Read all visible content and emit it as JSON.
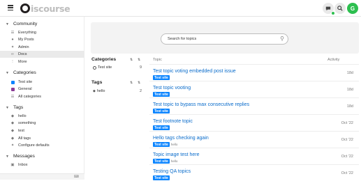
{
  "header": {
    "logo_text": "iscourse",
    "avatar_letter": "G",
    "icons": [
      "menu-icon",
      "chat-icon",
      "search-icon"
    ]
  },
  "coord_readout": "1332.4 × 44",
  "sidebar": {
    "community_label": "Community",
    "community_items": [
      {
        "label": "Everything",
        "icon": "layers-icon"
      },
      {
        "label": "My Posts",
        "icon": "user-icon"
      },
      {
        "label": "Admin",
        "icon": "wrench-icon"
      },
      {
        "label": "Docs",
        "icon": "link-icon",
        "active": true
      },
      {
        "label": "More",
        "icon": "ellipsis-icon"
      }
    ],
    "categories_label": "Categories",
    "category_items": [
      {
        "label": "Test site",
        "color": "#0a84ff"
      },
      {
        "label": "General",
        "color": "#8b3c95"
      },
      {
        "label": "All categories",
        "color": "#9a9a9a"
      }
    ],
    "tags_label": "Tags",
    "tag_items": [
      "hello",
      "something",
      "test",
      "All tags",
      "Configure defaults"
    ],
    "messages_label": "Messages",
    "message_items": [
      "Inbox"
    ],
    "footer_icon": "keyboard-icon"
  },
  "main": {
    "search_placeholder": "Search for topics",
    "categories_title": "Categories",
    "categories": [
      {
        "label": "Test site",
        "count": "9"
      }
    ],
    "tags_title": "Tags",
    "tags": [
      {
        "label": "hello",
        "count": "2"
      }
    ],
    "topic_header": "Topic",
    "activity_header": "Activity",
    "topics": [
      {
        "title": "Test topic voting embedded post issue",
        "category": "Test site",
        "tag": "",
        "activity": "18d"
      },
      {
        "title": "Test topic vooting",
        "category": "Test site",
        "tag": "",
        "activity": "18d"
      },
      {
        "title": "Test topic to bypass max consecutive replies",
        "category": "Test site",
        "tag": "",
        "activity": "18d"
      },
      {
        "title": "Test footnote topic",
        "category": "Test site",
        "tag": "",
        "activity": "Oct '22"
      },
      {
        "title": "Hello tags checking again",
        "category": "Test site",
        "tag": "hello",
        "activity": "Oct '22"
      },
      {
        "title": "Topic image test here",
        "category": "Test site",
        "tag": "hello",
        "activity": "Oct '22"
      },
      {
        "title": "Testing QA topics",
        "category": "Test site",
        "tag": "",
        "activity": "Oct '22"
      }
    ]
  },
  "colors": {
    "accent": "#0a6ccb",
    "badge": "#0a84ff",
    "avatar": "#2dbf4f"
  }
}
